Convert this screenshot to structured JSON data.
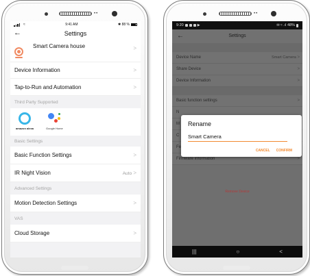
{
  "left": {
    "status": {
      "time": "9:41 AM",
      "battery": "88 %"
    },
    "header": {
      "title": "Settings",
      "back": "←"
    },
    "device": {
      "name": "Smart Camera house"
    },
    "rows_top": [
      {
        "label": "Device Information",
        "chevron": ">"
      },
      {
        "label": "Tap-to-Run and Automation",
        "chevron": ">"
      }
    ],
    "section_third_party": "Third Party Supported",
    "logos": {
      "alexa": "amazon alexa",
      "google": "Google Home"
    },
    "section_basic": "Basic Settings",
    "rows_basic": [
      {
        "label": "Basic Function Settings",
        "chevron": ">",
        "value": ""
      },
      {
        "label": "IR Night Vision",
        "chevron": ">",
        "value": "Auto"
      }
    ],
    "section_advanced": "Advanced Settings",
    "rows_advanced": [
      {
        "label": "Motion Detection Settings",
        "chevron": ">"
      }
    ],
    "section_vas": "VAS",
    "rows_vas": [
      {
        "label": "Cloud Storage",
        "chevron": ">"
      }
    ]
  },
  "right": {
    "status": {
      "time": "9:20",
      "battery": "48%"
    },
    "header": {
      "title": "Settings",
      "back": "←"
    },
    "rows_a": [
      {
        "label": "Device Name",
        "value": "Smart Camera",
        "chevron": ">"
      },
      {
        "label": "Share Device",
        "chevron": ">"
      },
      {
        "label": "Device Information",
        "chevron": ">"
      }
    ],
    "rows_b": [
      {
        "label": "Basic function settings",
        "chevron": ">"
      },
      {
        "label": "N",
        "chevron": ""
      },
      {
        "label": "M",
        "chevron": ""
      },
      {
        "label": "C",
        "chevron": ""
      },
      {
        "label": "Feedback",
        "chevron": ">"
      },
      {
        "label": "Firmware information",
        "chevron": ">"
      }
    ],
    "remove_label": "Remove Device",
    "dialog": {
      "title": "Rename",
      "value": "Smart Camera",
      "cancel": "CANCEL",
      "confirm": "CONFIRM"
    },
    "navbar": {
      "recents": "|||",
      "home": "○",
      "back": "<"
    }
  },
  "colors": {
    "accent_orange": "#f28a30",
    "camera_icon": "#f08a62",
    "alexa_blue": "#38b6e8",
    "remove_red": "#b23a3a"
  }
}
